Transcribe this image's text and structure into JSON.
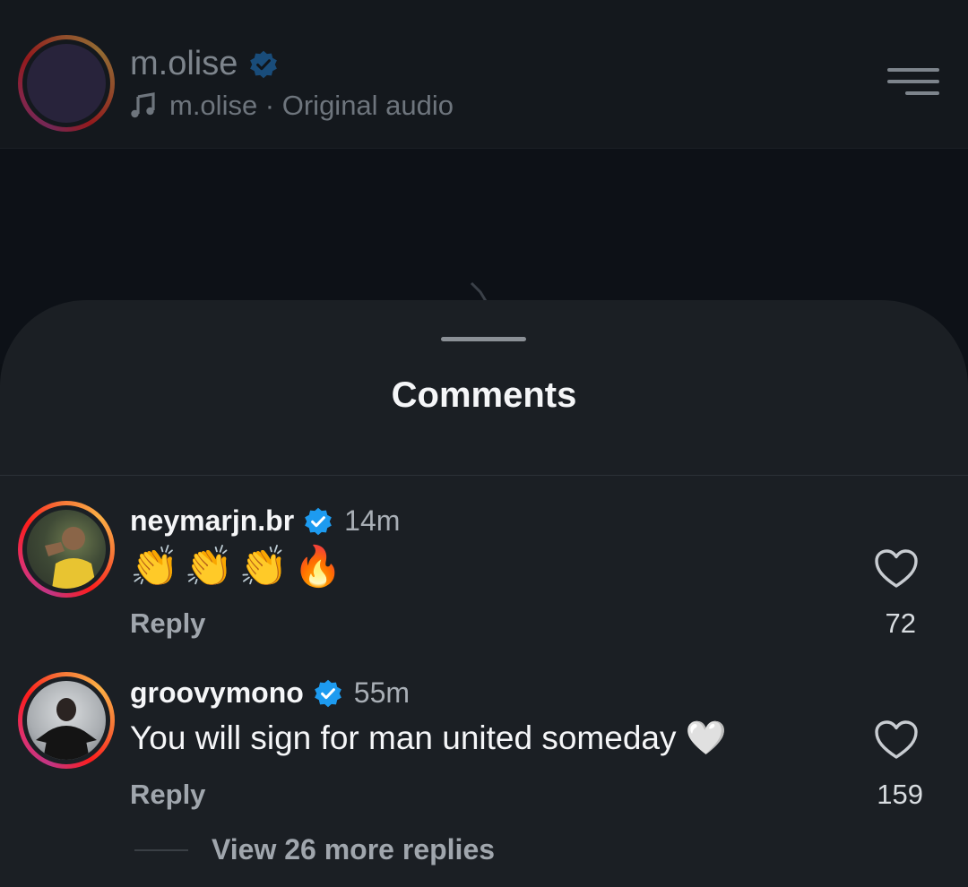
{
  "reel": {
    "username": "m.olise",
    "verified": true,
    "audio_icon": "music-note-icon",
    "audio_label": "m.olise · Original audio",
    "menu_icon": "menu-icon"
  },
  "sheet": {
    "title": "Comments"
  },
  "comments": [
    {
      "username": "neymarjn.br",
      "verified": true,
      "time": "14m",
      "text": "👏👏👏🔥",
      "reply_label": "Reply",
      "likes": "72"
    },
    {
      "username": "groovymono",
      "verified": true,
      "time": "55m",
      "text": "You will sign for man united someday 🤍",
      "reply_label": "Reply",
      "likes": "159"
    }
  ],
  "more_replies": {
    "label": "View 26 more replies"
  },
  "colors": {
    "verified_blue": "#1d9bf0",
    "sheet_bg": "#1b1f24",
    "story_ring": [
      "#c13584",
      "#fd1d1d",
      "#fcaf45"
    ]
  }
}
